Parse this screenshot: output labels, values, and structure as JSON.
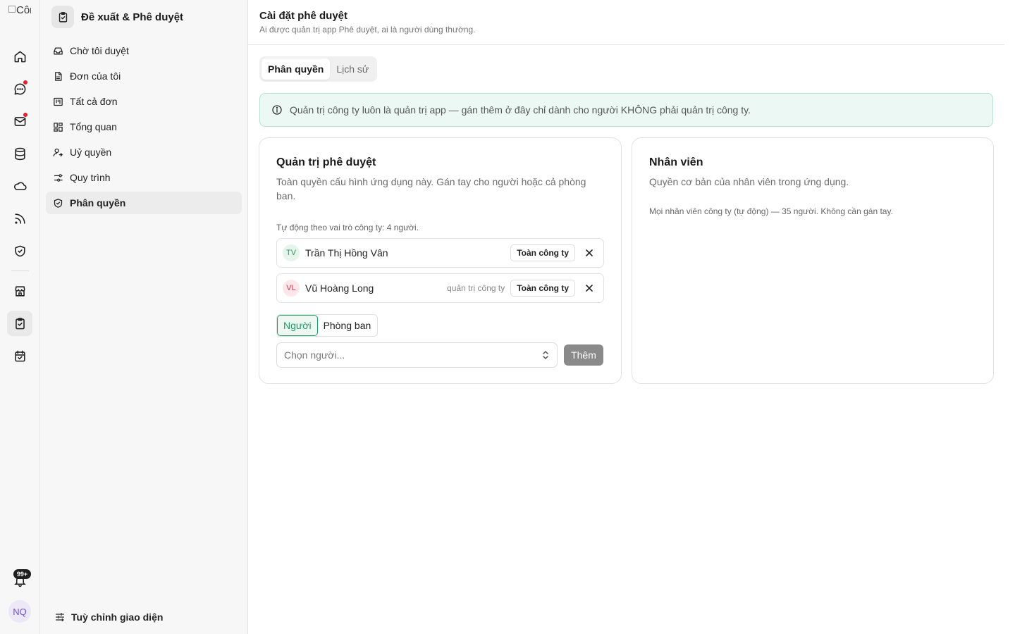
{
  "rail": {
    "logo_alt": "Côn",
    "badge": "99+",
    "avatar": "NQ",
    "icons": [
      "home-icon",
      "chat-icon",
      "mail-icon",
      "database-icon",
      "cloud-icon",
      "rss-icon",
      "shield-check-icon",
      "store-icon",
      "clipboard-check-icon",
      "calendar-check-icon",
      "bell-icon"
    ]
  },
  "sidebar": {
    "app_title": "Đề xuất & Phê duyệt",
    "items": [
      {
        "label": "Chờ tôi duyệt",
        "icon": "inbox-icon"
      },
      {
        "label": "Đơn của tôi",
        "icon": "document-icon"
      },
      {
        "label": "Tất cả đơn",
        "icon": "kanban-icon"
      },
      {
        "label": "Tổng quan",
        "icon": "dashboard-icon"
      },
      {
        "label": "Uỷ quyền",
        "icon": "user-delegate-icon"
      },
      {
        "label": "Quy trình",
        "icon": "workflow-icon"
      },
      {
        "label": "Phân quyền",
        "icon": "shield-icon",
        "active": true
      }
    ],
    "customize_label": "Tuỳ chỉnh giao diện"
  },
  "header": {
    "title": "Cài đặt phê duyệt",
    "subtitle": "Ai được quản trị app Phê duyệt, ai là người dùng thường."
  },
  "tabs": [
    {
      "label": "Phân quyền",
      "active": true
    },
    {
      "label": "Lịch sử",
      "active": false
    }
  ],
  "notice": "Quản trị công ty luôn là quản trị app — gán thêm ở đây chỉ dành cho người KHÔNG phải quản trị công ty.",
  "admin_card": {
    "title": "Quản trị phê duyệt",
    "description": "Toàn quyền cấu hình ứng dụng này. Gán tay cho người hoặc cả phòng ban.",
    "auto_note": "Tự động theo vai trò công ty: 4 người.",
    "members": [
      {
        "initials": "TV",
        "name": "Trần Thị Hồng Vân",
        "role": "",
        "scope": "Toàn công ty",
        "avatar_color": "green"
      },
      {
        "initials": "VL",
        "name": "Vũ Hoàng Long",
        "role": "quản trị công ty",
        "scope": "Toàn công ty",
        "avatar_color": "red"
      }
    ],
    "segments": [
      "Người",
      "Phòng ban"
    ],
    "picker_placeholder": "Chọn người...",
    "add_label": "Thêm"
  },
  "employee_card": {
    "title": "Nhân viên",
    "description": "Quyền cơ bản của nhân viên trong ứng dụng.",
    "note": "Mọi nhân viên công ty (tự động) — 35 người. Không cần gán tay."
  },
  "colors": {
    "accent_green": "#1e9a63",
    "notice_bg": "#ecf8f3",
    "notification_red": "#e5202e"
  }
}
